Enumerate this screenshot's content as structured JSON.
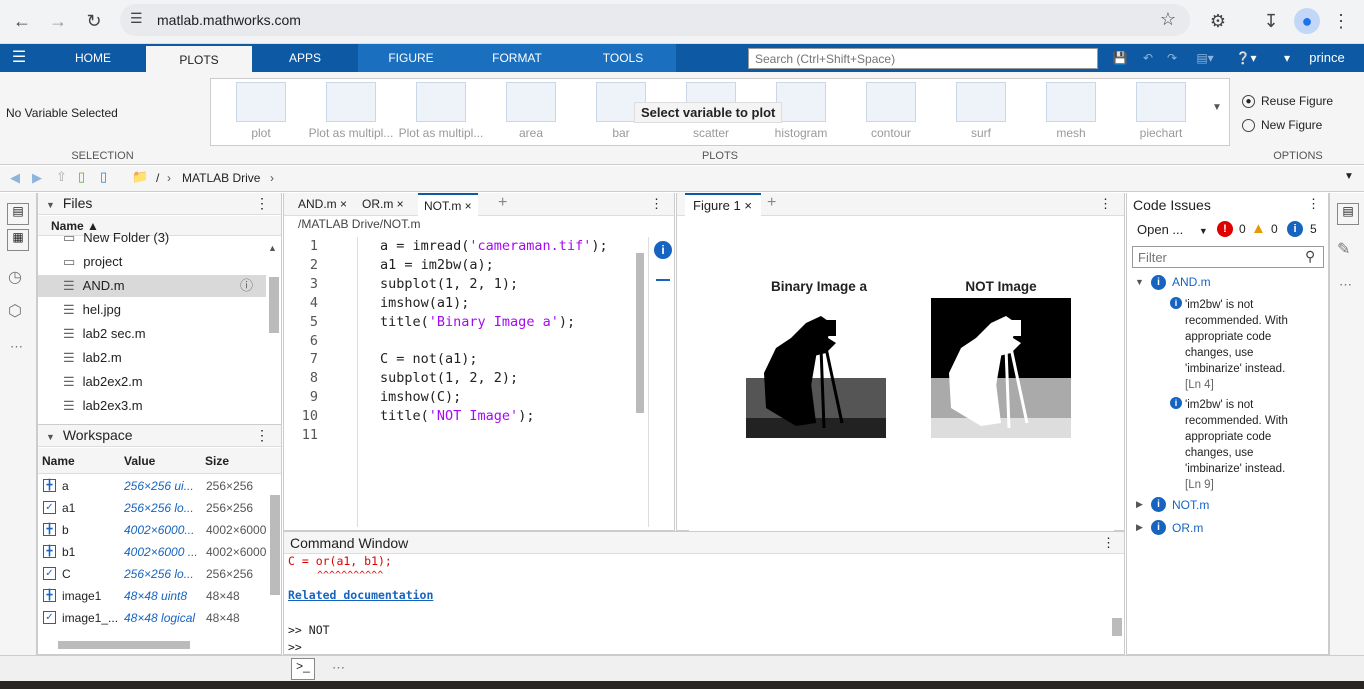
{
  "browser": {
    "url": "matlab.mathworks.com"
  },
  "tabs": {
    "home": "HOME",
    "plots": "PLOTS",
    "apps": "APPS",
    "figure": "FIGURE",
    "format": "FORMAT",
    "tools": "TOOLS"
  },
  "search": {
    "placeholder": "Search (Ctrl+Shift+Space)"
  },
  "user": "prince",
  "ribbon": {
    "selection_text": "No Variable Selected",
    "selection_label": "SELECTION",
    "plots_label": "PLOTS",
    "options_label": "OPTIONS",
    "overlay": "Select variable to plot",
    "plots": [
      "plot",
      "Plot as multipl...",
      "Plot as multipl...",
      "area",
      "bar",
      "scatter",
      "histogram",
      "contour",
      "surf",
      "mesh",
      "piechart"
    ],
    "reuse": "Reuse Figure",
    "new": "New Figure"
  },
  "address": {
    "sep": "/",
    "folder": "MATLAB Drive"
  },
  "files": {
    "title": "Files",
    "col_name": "Name",
    "items": [
      "New Folder (3)",
      "project",
      "AND.m",
      "hel.jpg",
      "lab2 sec.m",
      "lab2.m",
      "lab2ex2.m",
      "lab2ex3.m"
    ]
  },
  "workspace": {
    "title": "Workspace",
    "cols": [
      "Name",
      "Value",
      "Size"
    ],
    "rows": [
      {
        "name": "a",
        "value": "256×256 ui...",
        "size": "256×256"
      },
      {
        "name": "a1",
        "value": "256×256 lo...",
        "size": "256×256"
      },
      {
        "name": "b",
        "value": "4002×6000...",
        "size": "4002×6000"
      },
      {
        "name": "b1",
        "value": "4002×6000 ...",
        "size": "4002×6000"
      },
      {
        "name": "C",
        "value": "256×256 lo...",
        "size": "256×256"
      },
      {
        "name": "image1",
        "value": "48×48 uint8",
        "size": "48×48"
      },
      {
        "name": "image1_...",
        "value": "48×48 logical",
        "size": "48×48"
      }
    ]
  },
  "editor": {
    "tabs": [
      "AND.m",
      "OR.m",
      "NOT.m"
    ],
    "path": "/MATLAB Drive/NOT.m",
    "lines": [
      {
        "n": "1",
        "pre": "a = imread(",
        "str": "'cameraman.tif'",
        "post": ");"
      },
      {
        "n": "2",
        "pre": "a1 = im2bw(a);",
        "str": "",
        "post": ""
      },
      {
        "n": "3",
        "pre": "subplot(1, 2, 1);",
        "str": "",
        "post": ""
      },
      {
        "n": "4",
        "pre": "imshow(a1);",
        "str": "",
        "post": ""
      },
      {
        "n": "5",
        "pre": "title(",
        "str": "'Binary Image a'",
        "post": ");"
      },
      {
        "n": "6",
        "pre": "",
        "str": "",
        "post": ""
      },
      {
        "n": "7",
        "pre": "C = not(a1);",
        "str": "",
        "post": ""
      },
      {
        "n": "8",
        "pre": "subplot(1, 2, 2);",
        "str": "",
        "post": ""
      },
      {
        "n": "9",
        "pre": "imshow(C);",
        "str": "",
        "post": ""
      },
      {
        "n": "10",
        "pre": "title(",
        "str": "'NOT Image'",
        "post": ");"
      },
      {
        "n": "11",
        "pre": "",
        "str": "",
        "post": ""
      }
    ]
  },
  "figure": {
    "tab": "Figure 1",
    "left_title": "Binary Image a",
    "right_title": "NOT Image"
  },
  "command": {
    "title": "Command Window",
    "err_line": "C = or(a1, b1);",
    "carets": "^^^^^^^^^^^",
    "link": "Related documentation",
    "prompt1": ">> NOT",
    "prompt2": ">>"
  },
  "issues": {
    "title": "Code Issues",
    "open": "Open ...",
    "err_count": "0",
    "warn_count": "0",
    "info_count": "5",
    "filter_placeholder": "Filter",
    "file1": "AND.m",
    "msg1": "'im2bw' is not recommended. With appropriate code changes, use 'imbinarize' instead.",
    "ln1": "[Ln 4]",
    "msg2": "'im2bw' is not recommended. With appropriate code changes, use 'imbinarize' instead.",
    "ln2": "[Ln 9]",
    "file2": "NOT.m",
    "file3": "OR.m"
  }
}
